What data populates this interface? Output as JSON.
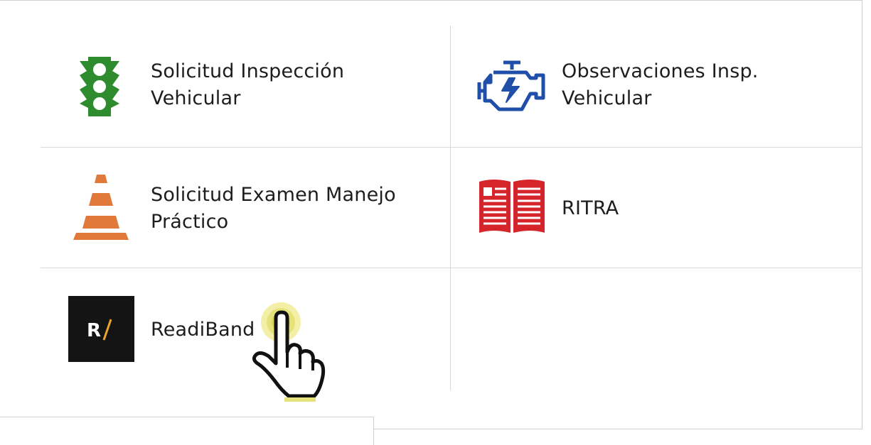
{
  "tiles": [
    {
      "id": "inspeccion",
      "label": "Solicitud Inspección\nVehicular",
      "icon": "traffic-light-icon",
      "color": "#2e8b2e"
    },
    {
      "id": "observaciones",
      "label": "Observaciones Insp.\nVehicular",
      "icon": "engine-icon",
      "color": "#1f4fa8"
    },
    {
      "id": "examen",
      "label": "Solicitud Examen Manejo\nPráctico",
      "icon": "traffic-cone-icon",
      "color": "#e0793a"
    },
    {
      "id": "ritra",
      "label": "RITRA",
      "icon": "open-book-icon",
      "color": "#d6252a"
    },
    {
      "id": "readiband",
      "label": "ReadiBand",
      "icon": "readiband-logo-icon",
      "color": "#141414",
      "logo_text": "R/"
    }
  ],
  "cursor": {
    "icon": "hand-pointer-cursor-icon",
    "highlight_color": "#e6e27a"
  }
}
